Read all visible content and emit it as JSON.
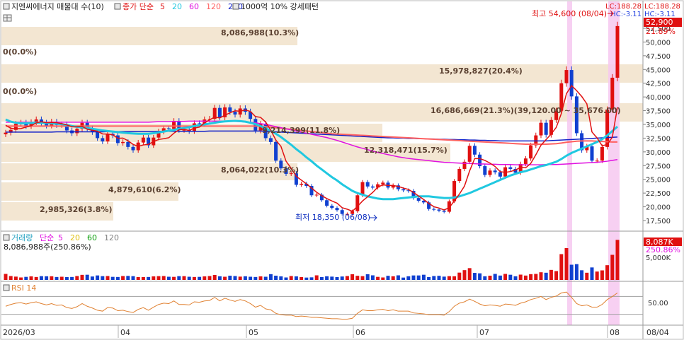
{
  "header": {
    "stock_name": "지엔씨에너지 매물대 수(10)",
    "ma_label": "종가 단순",
    "ma_periods": [
      "5",
      "20",
      "60",
      "120",
      "200"
    ],
    "ma_colors": [
      "#e01010",
      "#20c8e0",
      "#e010e0",
      "#ff6060",
      "#1020c8"
    ],
    "pattern_label": "1000억 10% 강세패턴",
    "lc_label": "LC:188.28",
    "hc_label": "HC:-3.11"
  },
  "price_panel": {
    "current_price": "52,900",
    "current_change": "21.89%",
    "high_annotation": "최고 54,600 (08/04)",
    "low_annotation": "최저 18,350 (06/08)",
    "y_ticks": [
      "52,500",
      "50,000",
      "47,500",
      "45,000",
      "42,500",
      "40,000",
      "37,500",
      "35,000",
      "32,500",
      "30,000",
      "27,500",
      "25,000",
      "22,500",
      "20,000",
      "17,500"
    ],
    "volume_profile_labels": [
      {
        "text": "8,086,988(10.3%)",
        "price": 49400
      },
      {
        "text": "0(0.0%)",
        "price": 46100
      },
      {
        "text": "15,978,827(20.4%)",
        "price": 42800
      },
      {
        "text": "0(0.0%)",
        "price": 39500
      },
      {
        "text": "16,686,669(21.3%)(39,120.00 ~ 35,676.00)",
        "price": 36200
      },
      {
        "text": "9,214,399(11.8%)",
        "price": 32900
      },
      {
        "text": "12,318,471(15.7%)",
        "price": 29600
      },
      {
        "text": "8,064,022(10.3%)",
        "price": 26300
      },
      {
        "text": "4,879,610(6.2%)",
        "price": 23000
      },
      {
        "text": "2,985,326(3.8%)",
        "price": 19700
      }
    ]
  },
  "volume_panel": {
    "legend_label": "거래량",
    "legend_ma_label": "단순",
    "legend_periods": [
      "5",
      "20",
      "60",
      "120"
    ],
    "legend_colors": [
      "#e010e0",
      "#e0c010",
      "#10a010",
      "#808080"
    ],
    "volume_text": "8,086,988주(250.86%)",
    "badge_value": "8,087K",
    "badge_pct": "250.86%",
    "tick_label": "5,000K"
  },
  "rsi_panel": {
    "label": "RSI 14",
    "tick_label": "50.00"
  },
  "x_axis": {
    "labels": [
      "2026/03",
      "04",
      "05",
      "06",
      "07",
      "08",
      "08/04"
    ]
  },
  "chart_data": {
    "type": "candlestick",
    "y_axis_range": [
      16000,
      56000
    ],
    "y_axis_side": "right",
    "grid": false,
    "dates": [
      "2026/03/01",
      "2026/08/04"
    ],
    "close": [
      33500,
      34000,
      35100,
      35300,
      34700,
      35400,
      35900,
      35300,
      34800,
      35500,
      34900,
      35000,
      33900,
      33400,
      34200,
      35300,
      34300,
      33600,
      32500,
      31900,
      33300,
      33000,
      31600,
      31800,
      30900,
      30300,
      31700,
      32600,
      31200,
      32600,
      33700,
      34300,
      34200,
      35600,
      34000,
      34000,
      33800,
      35200,
      35100,
      35900,
      36000,
      38000,
      36300,
      38100,
      37300,
      36800,
      37900,
      37300,
      36000,
      33900,
      35100,
      32500,
      31800,
      28400,
      27000,
      26000,
      26100,
      24000,
      24200,
      23800,
      22100,
      22200,
      21200,
      20200,
      19800,
      19400,
      18700,
      18700,
      19200,
      22100,
      24500,
      23700,
      23500,
      24100,
      24400,
      23500,
      23900,
      23200,
      23000,
      22900,
      21600,
      21100,
      20800,
      19600,
      19500,
      19300,
      19100,
      21000,
      24700,
      26900,
      28200,
      31100,
      29500,
      27400,
      25800,
      26600,
      26300,
      25500,
      27200,
      26900,
      26200,
      27800,
      28800,
      31200,
      33000,
      35300,
      33100,
      35800,
      37500,
      42500,
      44900,
      40100,
      33400,
      30300,
      31000,
      28400,
      28400,
      30900,
      37700,
      43500,
      52900
    ],
    "volume": [
      5.1,
      3.3,
      2.8,
      2.1,
      2.6,
      3.0,
      2.5,
      3.2,
      3.1,
      3.1,
      2.5,
      2.7,
      2.4,
      2.5,
      3.3,
      4.3,
      4.4,
      2.9,
      3.8,
      3.2,
      3.3,
      2.6,
      2.5,
      3.3,
      3.4,
      3.2,
      2.4,
      2.4,
      2.5,
      3.0,
      3.2,
      3.3,
      2.7,
      2.6,
      3.2,
      3.2,
      2.7,
      2.5,
      2.6,
      3.0,
      3.3,
      4.2,
      3.1,
      2.7,
      3.6,
      3.3,
      2.8,
      3.1,
      2.7,
      2.5,
      3.0,
      2.7,
      4.9,
      3.6,
      3.0,
      2.1,
      3.3,
      3.0,
      2.4,
      2.0,
      2.2,
      3.9,
      2.4,
      3.1,
      2.8,
      2.4,
      2.9,
      3.3,
      4.8,
      3.5,
      3.2,
      4.8,
      3.9,
      2.6,
      2.1,
      3.5,
      3.1,
      3.9,
      2.0,
      3.1,
      3.8,
      3.8,
      4.4,
      2.4,
      3.3,
      3.5,
      2.8,
      3.2,
      3.1,
      6.2,
      8.3,
      10.0,
      6.0,
      5.6,
      3.1,
      3.6,
      5.1,
      3.7,
      5.1,
      4.4,
      3.1,
      4.5,
      3.7,
      4.9,
      5.1,
      6.5,
      6.1,
      8.5,
      7.5,
      21.9,
      27.0,
      12.9,
      13.4,
      8.2,
      6.1,
      10.6,
      7.1,
      8.1,
      12.5,
      21.3,
      34.0
    ],
    "rsi": [
      48,
      52,
      55,
      56,
      53,
      56,
      58,
      54,
      51,
      54,
      50,
      51,
      45,
      43,
      47,
      54,
      48,
      44,
      39,
      37,
      45,
      44,
      38,
      39,
      36,
      34,
      41,
      45,
      39,
      46,
      52,
      55,
      54,
      60,
      52,
      52,
      51,
      58,
      57,
      60,
      61,
      68,
      60,
      66,
      62,
      59,
      63,
      60,
      54,
      46,
      50,
      42,
      40,
      32,
      29,
      28,
      28,
      25,
      26,
      25,
      23,
      23,
      22,
      21,
      20,
      20,
      19,
      19,
      21,
      32,
      40,
      38,
      38,
      40,
      41,
      38,
      40,
      37,
      37,
      37,
      33,
      32,
      31,
      29,
      29,
      29,
      28,
      36,
      48,
      55,
      58,
      64,
      59,
      53,
      49,
      51,
      50,
      48,
      53,
      52,
      50,
      55,
      58,
      63,
      66,
      70,
      63,
      68,
      71,
      78,
      80,
      68,
      54,
      49,
      51,
      46,
      46,
      52,
      63,
      70,
      78
    ],
    "ma5": [
      34850,
      34290,
      34190,
      34250,
      34520,
      34760,
      35280,
      35480,
      35300,
      35350,
      35300,
      35150,
      34900,
      34570,
      34560,
      34640,
      34130,
      33940,
      33760,
      33270,
      33240,
      33100,
      32480,
      32510,
      32030,
      31360,
      31000,
      31260,
      31370,
      31880,
      32260,
      32400,
      32580,
      33400,
      34020,
      34100,
      33900,
      34330,
      34510,
      35270,
      35840,
      36330,
      36180,
      36670,
      37120,
      37480,
      37400,
      37640,
      37360,
      36430,
      36280,
      35430,
      33940,
      32140,
      31000,
      28300,
      27020,
      25540,
      24860,
      24180,
      23420,
      22650,
      22040,
      21500,
      21060,
      20660,
      19840,
      19560,
      19190,
      20060,
      21060,
      21840,
      22620,
      23590,
      24000,
      23880,
      23880,
      23710,
      23410,
      23170,
      22620,
      21960,
      21330,
      20620,
      20020,
      19780,
      19420,
      19850,
      21070,
      22310,
      23790,
      26530,
      28780,
      28780,
      28440,
      27960,
      27340,
      26400,
      26270,
      26420,
      26690,
      27180,
      27100,
      27900,
      29480,
      31220,
      32240,
      33240,
      34460,
      37000,
      40600,
      42060,
      41150,
      40080,
      38750,
      33620,
      32540,
      31120,
      31330,
      32690,
      38140
    ],
    "ma20": [
      35900,
      35500,
      35300,
      35200,
      35200,
      35250,
      35300,
      35300,
      35250,
      35200,
      35150,
      35050,
      34900,
      34700,
      34550,
      34450,
      34350,
      34200,
      34050,
      33900,
      33800,
      33700,
      33600,
      33500,
      33400,
      33350,
      33300,
      33300,
      33300,
      33400,
      33550,
      33700,
      33850,
      34000,
      34200,
      34350,
      34500,
      34700,
      34850,
      35000,
      35150,
      35300,
      35450,
      35550,
      35600,
      35650,
      35600,
      35500,
      35300,
      35050,
      34700,
      34300,
      33850,
      33300,
      32700,
      32000,
      31300,
      30500,
      29800,
      29000,
      28300,
      27500,
      26800,
      26100,
      25400,
      24800,
      24100,
      23500,
      22900,
      22500,
      22200,
      21900,
      21700,
      21500,
      21400,
      21400,
      21400,
      21500,
      21600,
      21700,
      21800,
      21900,
      21900,
      21900,
      21800,
      21700,
      21600,
      21600,
      21700,
      21900,
      22200,
      22500,
      22900,
      23300,
      23700,
      24100,
      24500,
      24900,
      25300,
      25700,
      26000,
      26300,
      26500,
      26800,
      27100,
      27400,
      27600,
      27900,
      28200,
      28700,
      29300,
      29800,
      30200,
      30600,
      31000,
      31400,
      31800,
      32300,
      33000,
      33800,
      34600
    ],
    "ma60": [
      35400,
      35400,
      35400,
      35400,
      35400,
      35400,
      35400,
      35400,
      35400,
      35400,
      35400,
      35400,
      35400,
      35400,
      35400,
      35400,
      35400,
      35400,
      35400,
      35400,
      35400,
      35400,
      35400,
      35400,
      35400,
      35400,
      35400,
      35400,
      35400,
      35450,
      35500,
      35500,
      35500,
      35550,
      35550,
      35550,
      35600,
      35600,
      35600,
      35600,
      35600,
      35600,
      35600,
      35600,
      35600,
      35550,
      35500,
      35450,
      35400,
      35300,
      35150,
      35000,
      34800,
      34600,
      34400,
      34200,
      34000,
      33800,
      33600,
      33400,
      33200,
      33000,
      32800,
      32600,
      32350,
      32100,
      31800,
      31500,
      31200,
      30900,
      30650,
      30400,
      30150,
      29900,
      29700,
      29500,
      29300,
      29100,
      28950,
      28800,
      28700,
      28600,
      28500,
      28400,
      28300,
      28200,
      28100,
      28050,
      28000,
      27950,
      27900,
      27900,
      27850,
      27800,
      27800,
      27750,
      27750,
      27700,
      27700,
      27700,
      27650,
      27650,
      27650,
      27650,
      27650,
      27650,
      27700,
      27700,
      27700,
      27750,
      27800,
      27850,
      27900,
      27950,
      28000,
      28050,
      28100,
      28200,
      28300,
      28450,
      28600
    ],
    "ma120": [
      34700,
      34700,
      34700,
      34700,
      34700,
      34700,
      34700,
      34700,
      34700,
      34700,
      34700,
      34700,
      34700,
      34700,
      34700,
      34700,
      34700,
      34700,
      34700,
      34700,
      34700,
      34700,
      34700,
      34700,
      34700,
      34700,
      34700,
      34700,
      34700,
      34700,
      34700,
      34700,
      34700,
      34700,
      34700,
      34700,
      34700,
      34700,
      34700,
      34700,
      34700,
      34700,
      34700,
      34700,
      34700,
      34700,
      34700,
      34700,
      34700,
      34700,
      34700,
      34600,
      34500,
      34400,
      34300,
      34200,
      34100,
      34000,
      33900,
      33800,
      33700,
      33600,
      33500,
      33400,
      33300,
      33250,
      33200,
      33150,
      33100,
      33050,
      33000,
      32950,
      32900,
      32850,
      32800,
      32750,
      32700,
      32650,
      32600,
      32550,
      32500,
      32450,
      32400,
      32350,
      32300,
      32250,
      32200,
      32150,
      32100,
      32050,
      32000,
      31950,
      31900,
      31850,
      31800,
      31750,
      31700,
      31650,
      31600,
      31550,
      31500,
      31450,
      31400,
      31400,
      31400,
      31400,
      31400,
      31450,
      31500,
      31600,
      31750,
      31850,
      31950,
      32000,
      32000,
      32000,
      31950,
      31900,
      31850,
      31800,
      31800
    ],
    "ma200": [
      33600,
      33600,
      33600,
      33600,
      33600,
      33600,
      33600,
      33600,
      33600,
      33600,
      33650,
      33650,
      33650,
      33650,
      33650,
      33650,
      33650,
      33650,
      33650,
      33650,
      33700,
      33700,
      33700,
      33700,
      33700,
      33700,
      33700,
      33700,
      33700,
      33700,
      33750,
      33750,
      33750,
      33750,
      33750,
      33750,
      33750,
      33750,
      33750,
      33750,
      33800,
      33800,
      33800,
      33800,
      33800,
      33800,
      33800,
      33800,
      33800,
      33800,
      33800,
      33750,
      33700,
      33650,
      33600,
      33550,
      33500,
      33450,
      33400,
      33350,
      33300,
      33250,
      33200,
      33150,
      33100,
      33050,
      33000,
      32950,
      32900,
      32850,
      32800,
      32750,
      32700,
      32650,
      32600,
      32550,
      32550,
      32500,
      32500,
      32450,
      32450,
      32400,
      32400,
      32350,
      32350,
      32300,
      32300,
      32250,
      32250,
      32200,
      32200,
      32150,
      32150,
      32100,
      32100,
      32050,
      32050,
      32000,
      32000,
      32000,
      32000,
      32000,
      32000,
      32000,
      32000,
      32000,
      32000,
      32050,
      32100,
      32150,
      32200,
      32250,
      32300,
      32350,
      32400,
      32450,
      32500,
      32550,
      32600,
      32650,
      32700
    ]
  }
}
